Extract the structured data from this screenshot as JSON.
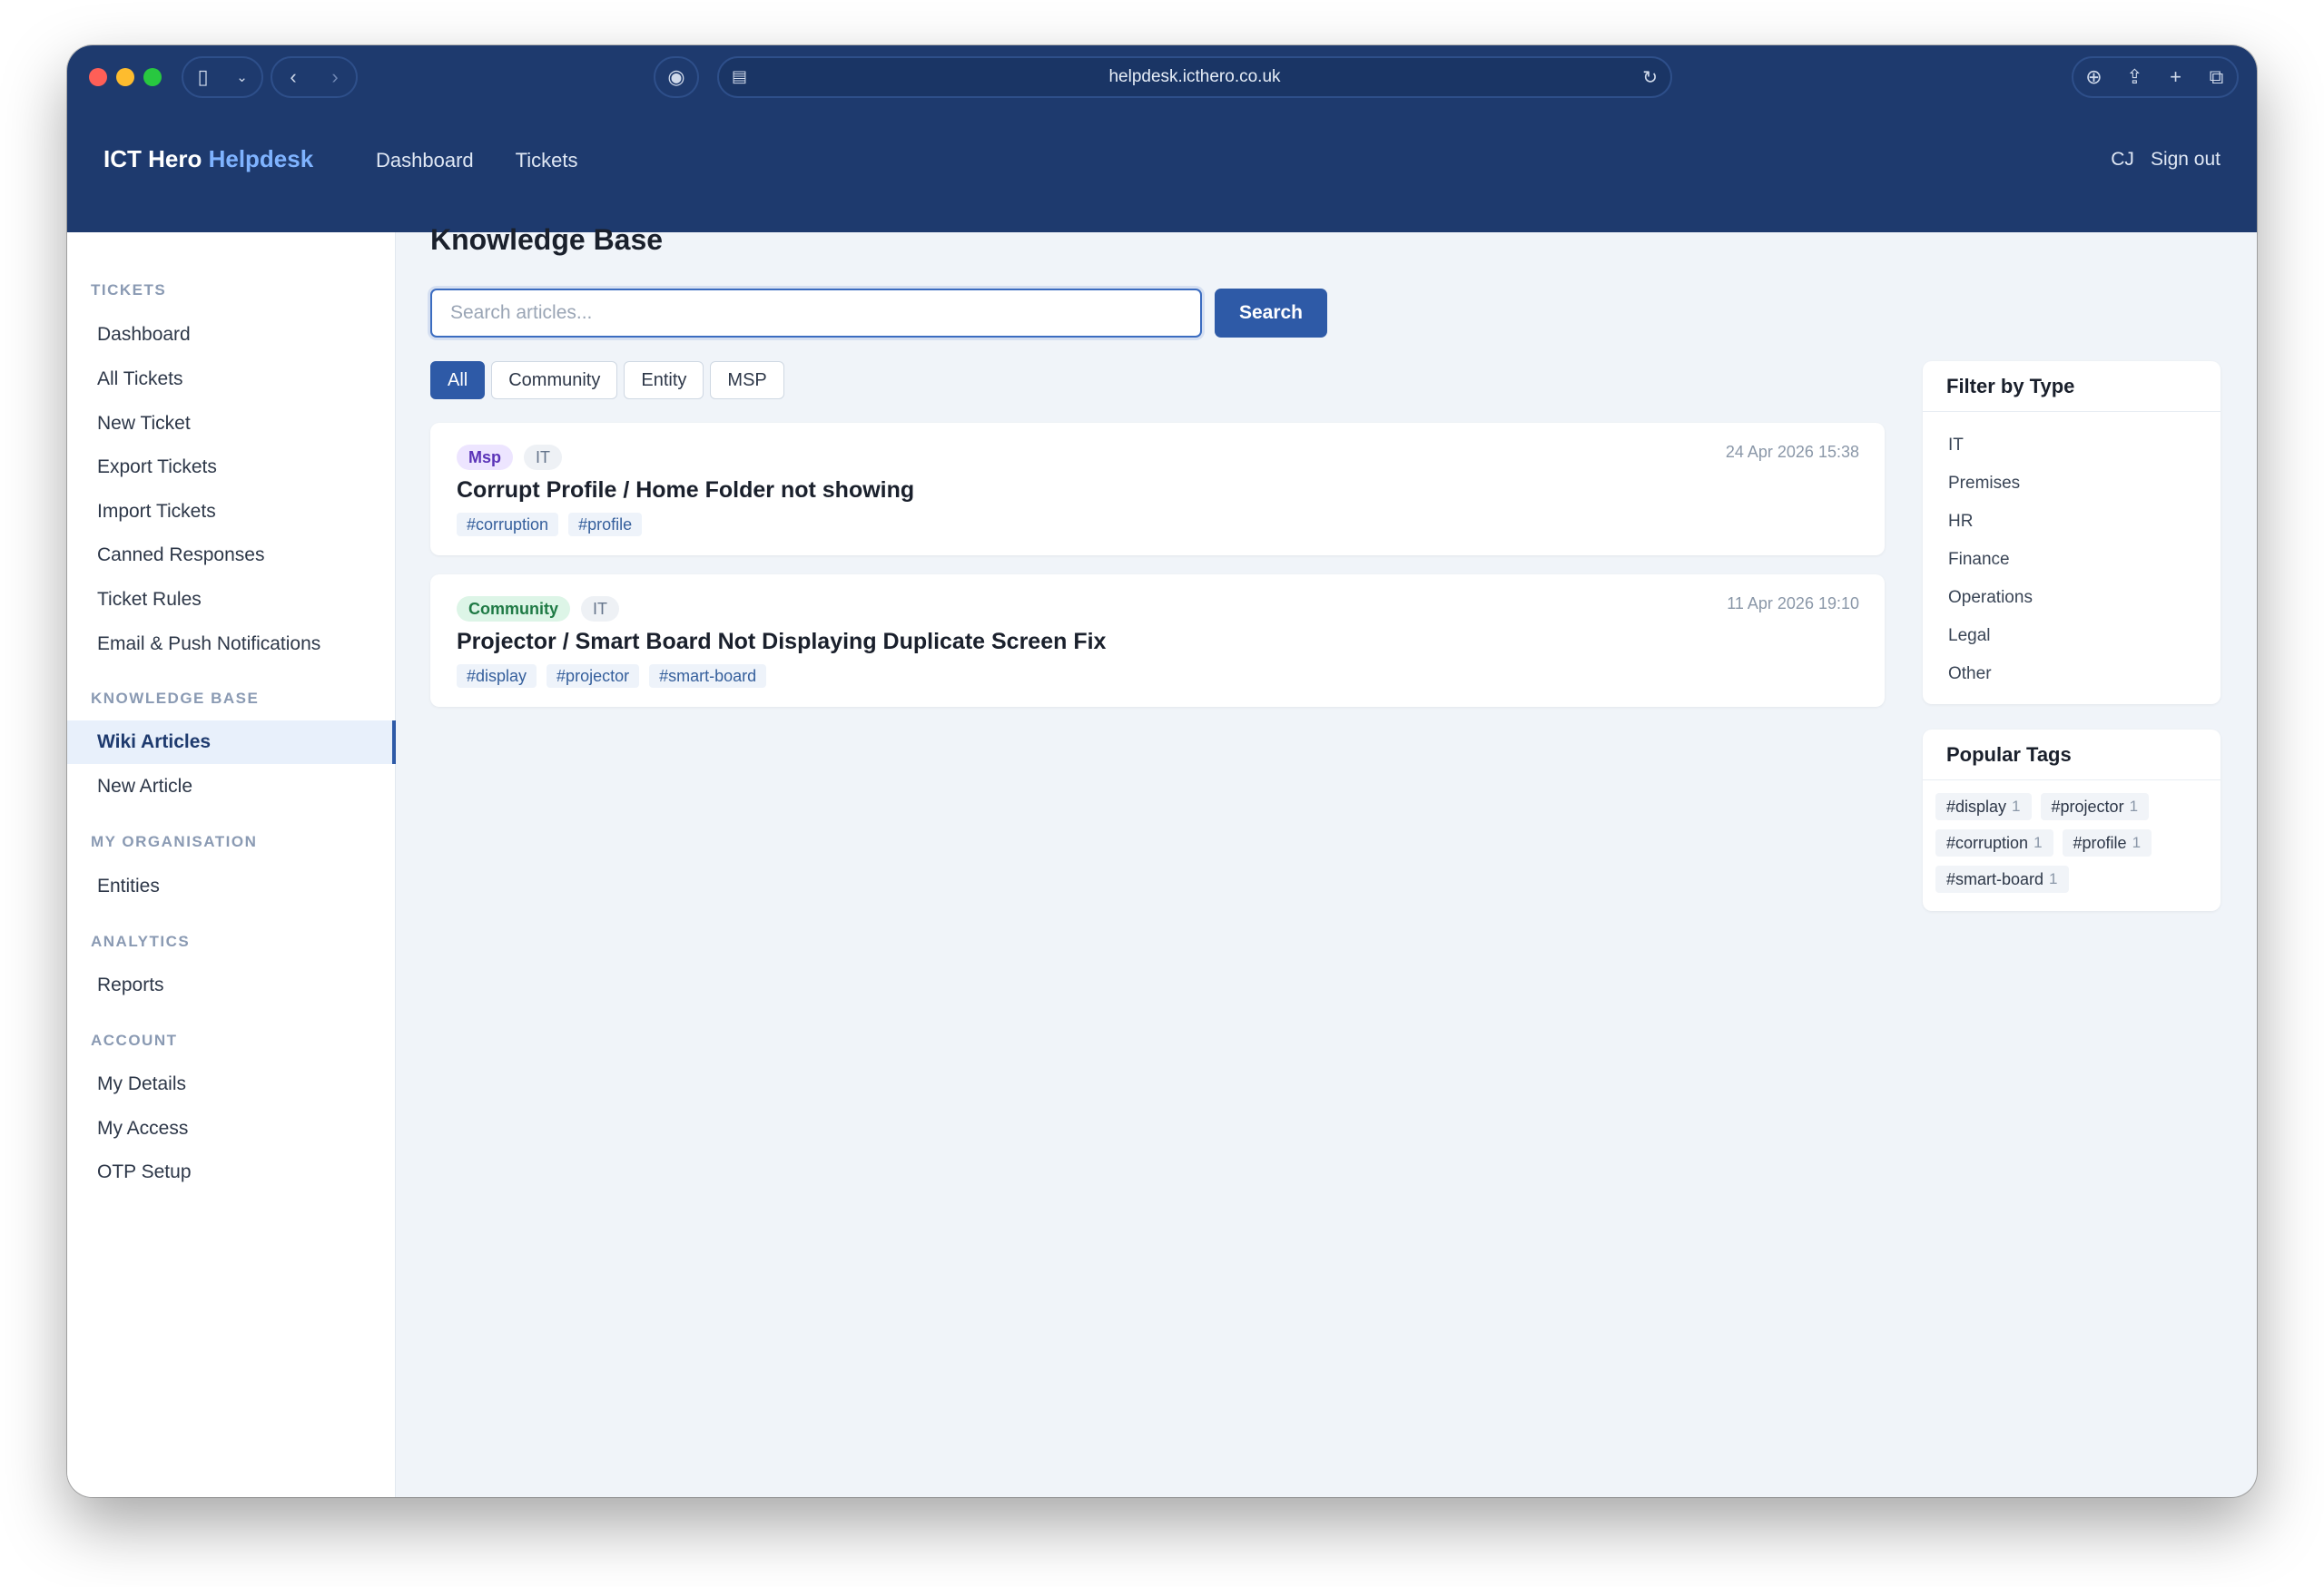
{
  "browser": {
    "url": "helpdesk.icthero.co.uk"
  },
  "header": {
    "brand_main": "ICT Hero",
    "brand_accent": "Helpdesk",
    "nav": [
      "Dashboard",
      "Tickets"
    ],
    "user_initials": "CJ",
    "sign_out": "Sign out"
  },
  "sidebar": {
    "sections": [
      {
        "heading": "TICKETS",
        "items": [
          "Dashboard",
          "All Tickets",
          "New Ticket",
          "Export Tickets",
          "Import Tickets",
          "Canned Responses",
          "Ticket Rules",
          "Email & Push Notifications"
        ]
      },
      {
        "heading": "KNOWLEDGE BASE",
        "items": [
          "Wiki Articles",
          "New Article"
        ]
      },
      {
        "heading": "MY ORGANISATION",
        "items": [
          "Entities"
        ]
      },
      {
        "heading": "ANALYTICS",
        "items": [
          "Reports"
        ]
      },
      {
        "heading": "ACCOUNT",
        "items": [
          "My Details",
          "My Access",
          "OTP Setup"
        ]
      }
    ],
    "active_item": "Wiki Articles"
  },
  "main": {
    "title": "Knowledge Base",
    "search": {
      "placeholder": "Search articles...",
      "value": "",
      "button": "Search"
    },
    "filter_tabs": [
      "All",
      "Community",
      "Entity",
      "MSP"
    ],
    "active_tab": "All",
    "articles": [
      {
        "scope_badge": "Msp",
        "type_badge": "IT",
        "date": "24 Apr 2026 15:38",
        "title": "Corrupt Profile / Home Folder not showing",
        "tags": [
          "#corruption",
          "#profile"
        ]
      },
      {
        "scope_badge": "Community",
        "type_badge": "IT",
        "date": "11 Apr 2026 19:10",
        "title": "Projector / Smart Board Not Displaying Duplicate Screen Fix",
        "tags": [
          "#display",
          "#projector",
          "#smart-board"
        ]
      }
    ]
  },
  "filter_panel": {
    "title": "Filter by Type",
    "types": [
      "IT",
      "Premises",
      "HR",
      "Finance",
      "Operations",
      "Legal",
      "Other"
    ]
  },
  "tags_panel": {
    "title": "Popular Tags",
    "tags": [
      {
        "name": "#display",
        "count": "1"
      },
      {
        "name": "#projector",
        "count": "1"
      },
      {
        "name": "#corruption",
        "count": "1"
      },
      {
        "name": "#profile",
        "count": "1"
      },
      {
        "name": "#smart-board",
        "count": "1"
      }
    ]
  },
  "colors": {
    "header_bg": "#1e3a6e",
    "accent": "#2e5aa7",
    "brand_accent": "#7fb3ff",
    "msp_badge": "#ede5ff",
    "community_badge": "#ddf5e7"
  }
}
